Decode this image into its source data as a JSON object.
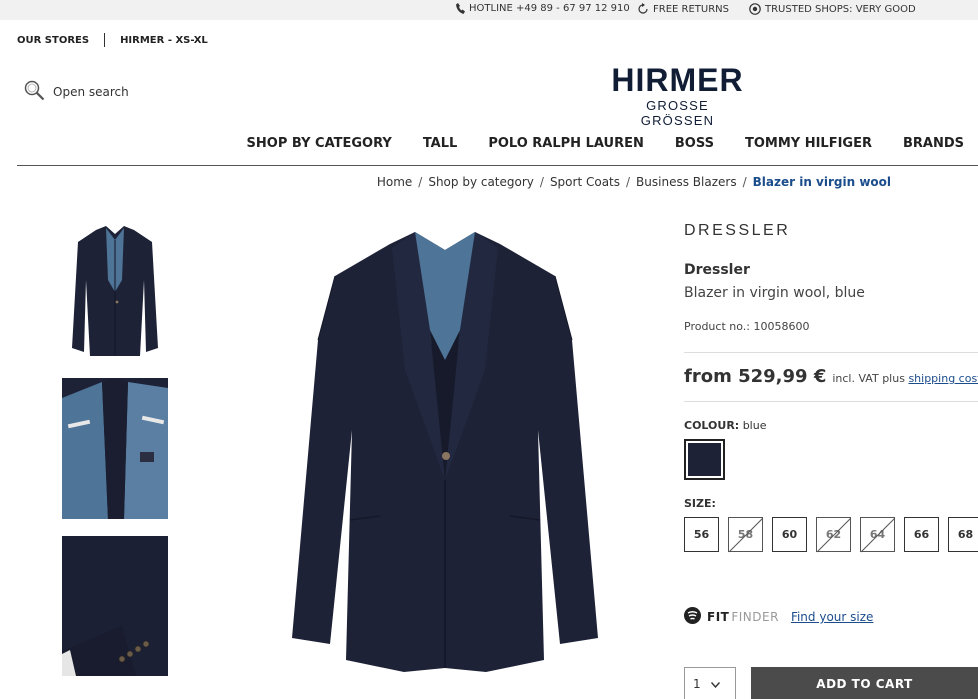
{
  "topbar": {
    "hotline": "HOTLINE +49 89 - 67 97 12 910",
    "returns": "FREE RETURNS",
    "trusted": "TRUSTED SHOPS: VERY GOOD"
  },
  "store_links": {
    "our_stores": "OUR STORES",
    "hirmer_xs_xl": "HIRMER - XS-XL"
  },
  "search": {
    "label": "Open search"
  },
  "logo": {
    "line1": "HIRMER",
    "line2": "GROSSE GRÖSSEN"
  },
  "nav": {
    "items": [
      {
        "label": "SHOP BY CATEGORY"
      },
      {
        "label": "TALL"
      },
      {
        "label": "POLO RALPH LAUREN"
      },
      {
        "label": "BOSS"
      },
      {
        "label": "TOMMY HILFIGER"
      },
      {
        "label": "BRANDS"
      }
    ]
  },
  "breadcrumb": {
    "items": [
      "Home",
      "Shop by category",
      "Sport Coats",
      "Business Blazers"
    ],
    "current": "Blazer in virgin wool"
  },
  "product": {
    "brand_logo": "DRESSLER",
    "brand": "Dressler",
    "name": "Blazer in virgin wool, blue",
    "product_no": "Product no.: 10058600",
    "price": "from 529,99 €",
    "vat_text": "incl. VAT plus",
    "shipping_link": "shipping costs",
    "colour_label": "COLOUR:",
    "colour_value": "blue",
    "colour_swatch": "#1e2236",
    "size_label": "SIZE:",
    "sizes": [
      {
        "label": "56",
        "available": true
      },
      {
        "label": "58",
        "available": false
      },
      {
        "label": "60",
        "available": true
      },
      {
        "label": "62",
        "available": false
      },
      {
        "label": "64",
        "available": false
      },
      {
        "label": "66",
        "available": true
      },
      {
        "label": "68",
        "available": true
      }
    ],
    "fit_finder_fit": "FIT",
    "fit_finder_finder": "FINDER",
    "fit_finder_link": "Find your size",
    "quantity": "1",
    "add_to_cart": "ADD TO CART"
  },
  "colors": {
    "link_blue": "#1b4d8c",
    "logo_navy": "#101d35",
    "cart_button": "#4b4b4b",
    "blazer_navy": "#1e2236",
    "lining_blue": "#4e7497"
  }
}
